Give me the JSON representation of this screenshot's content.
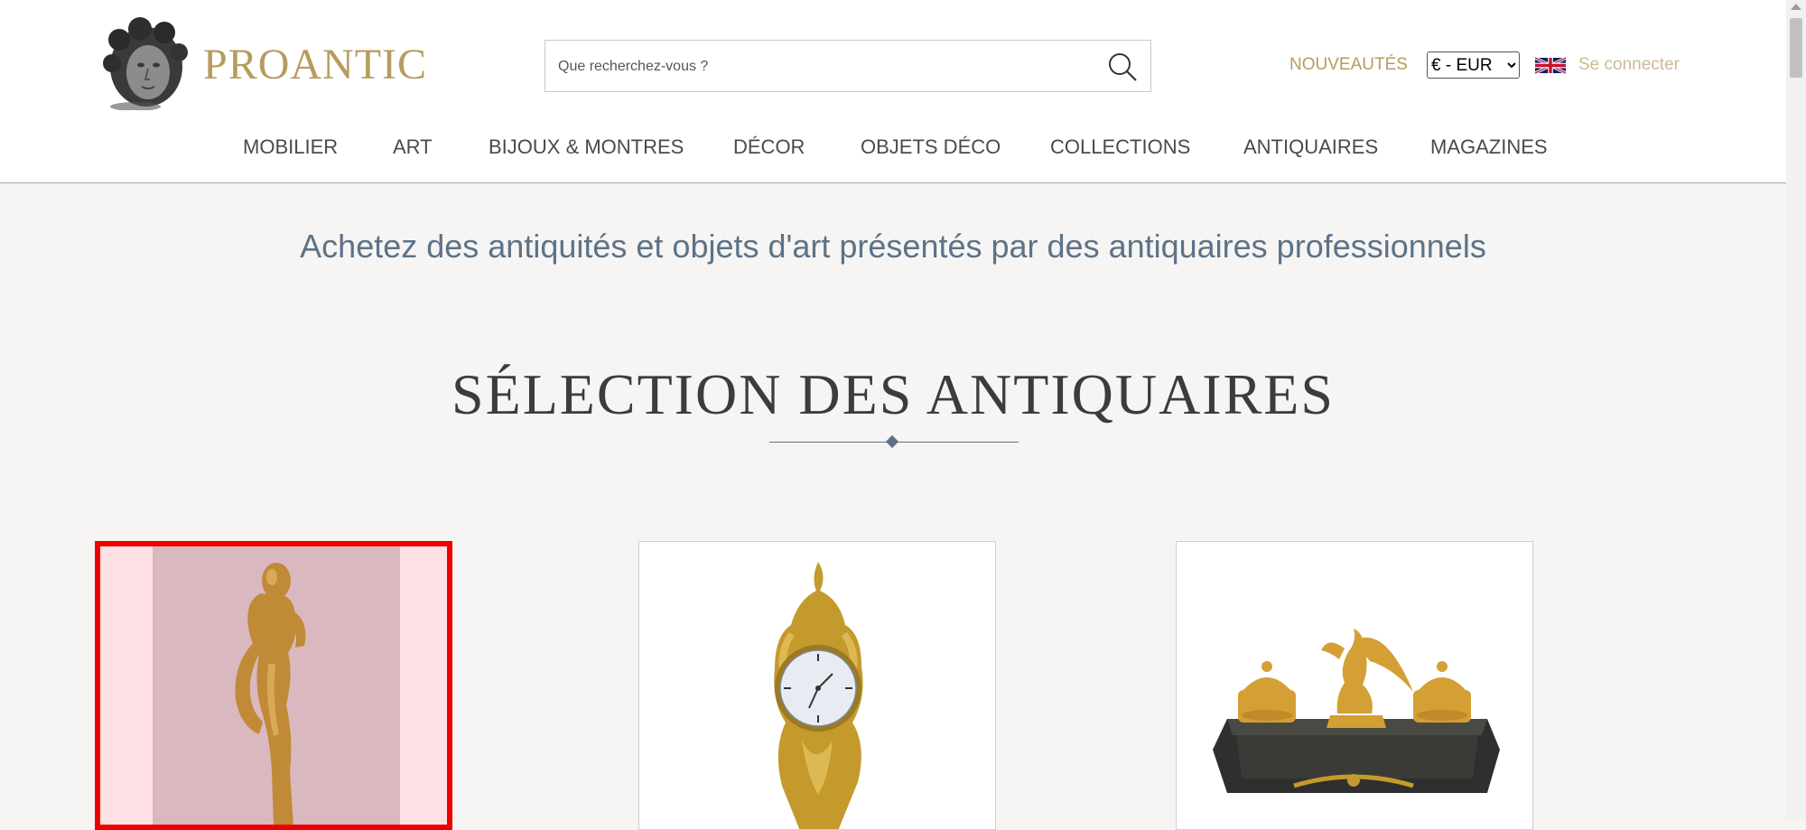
{
  "header": {
    "logo_text": "PROANTIC",
    "search_placeholder": "Que recherchez-vous ?",
    "nouveautes": "NOUVEAUTÉS",
    "currency_selected": "€ - EUR",
    "login": "Se connecter"
  },
  "nav": {
    "items": [
      {
        "label": "MOBILIER"
      },
      {
        "label": "ART"
      },
      {
        "label": "BIJOUX & MONTRES"
      },
      {
        "label": "DÉCOR"
      },
      {
        "label": "OBJETS DÉCO"
      },
      {
        "label": "COLLECTIONS"
      },
      {
        "label": "ANTIQUAIRES"
      },
      {
        "label": "MAGAZINES"
      }
    ]
  },
  "main": {
    "tagline": "Achetez des antiquités et objets d'art présentés par des antiquaires professionnels",
    "section_title": "SÉLECTION DES ANTIQUAIRES"
  },
  "colors": {
    "brand_gold": "#b69c5d",
    "tagline_blue": "#5d7288",
    "selection_red": "#ee0000"
  }
}
